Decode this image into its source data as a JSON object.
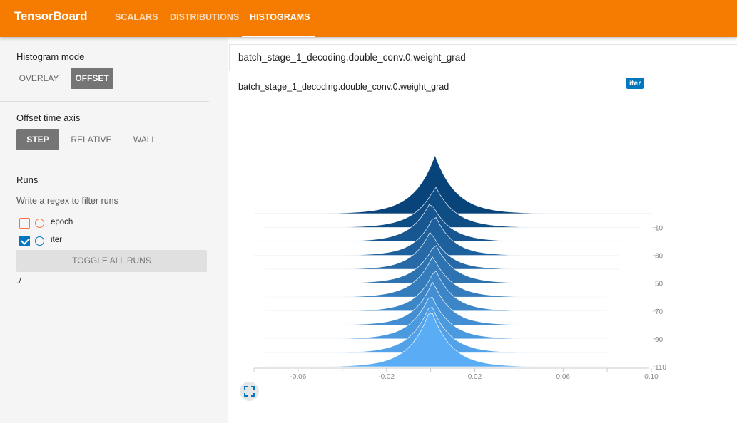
{
  "app": {
    "title": "TensorBoard",
    "tabs": [
      {
        "label": "SCALARS",
        "active": false
      },
      {
        "label": "DISTRIBUTIONS",
        "active": false
      },
      {
        "label": "HISTOGRAMS",
        "active": true
      }
    ],
    "accent_color": "#f57c00"
  },
  "sidebar": {
    "histogram_mode": {
      "title": "Histogram mode",
      "options": [
        "OVERLAY",
        "OFFSET"
      ],
      "selected": "OFFSET"
    },
    "offset_axis": {
      "title": "Offset time axis",
      "options": [
        "STEP",
        "RELATIVE",
        "WALL"
      ],
      "selected": "STEP"
    },
    "runs": {
      "title": "Runs",
      "filter_placeholder": "Write a regex to filter runs",
      "items": [
        {
          "name": "epoch",
          "checked": false,
          "color": "#ff7043"
        },
        {
          "name": "iter",
          "checked": true,
          "color": "#0277bd"
        }
      ],
      "toggle_all_label": "TOGGLE ALL RUNS",
      "logdir": "./"
    }
  },
  "main": {
    "tag_header": "batch_stage_1_decoding.double_conv.0.weight_grad",
    "card_title": "batch_stage_1_decoding.double_conv.0.weight_grad",
    "run_badge": "iter",
    "expand_icon": "fullscreen-icon"
  },
  "chart_data": {
    "type": "area",
    "mode": "offset",
    "x_axis": {
      "ticks": [
        "-0.06",
        "-0.02",
        "0.02",
        "0.06",
        "0.10"
      ],
      "tick_values": [
        -0.06,
        -0.02,
        0.02,
        0.06,
        0.1
      ],
      "range": [
        -0.08,
        0.1
      ]
    },
    "y_axis": {
      "label_ticks": [
        "10",
        "30",
        "50",
        "70",
        "90",
        "110"
      ],
      "tick_values": [
        10,
        30,
        50,
        70,
        90,
        110
      ],
      "range": [
        0,
        110
      ],
      "position": "right"
    },
    "series": [
      {
        "step": 0,
        "peak": 0.002,
        "height": 82,
        "spread": 0.0095,
        "left": -0.08,
        "right": 0.1
      },
      {
        "step": 10,
        "peak": 0.0022,
        "height": 58,
        "spread": 0.009,
        "left": -0.075,
        "right": 0.095
      },
      {
        "step": 20,
        "peak": 0.0,
        "height": 56,
        "spread": 0.0085,
        "left": -0.08,
        "right": 0.09
      },
      {
        "step": 30,
        "peak": 0.0018,
        "height": 58,
        "spread": 0.008,
        "left": -0.08,
        "right": 0.085
      },
      {
        "step": 40,
        "peak": 0.0,
        "height": 54,
        "spread": 0.008,
        "left": -0.075,
        "right": 0.085
      },
      {
        "step": 50,
        "peak": 0.002,
        "height": 56,
        "spread": 0.0085,
        "left": -0.075,
        "right": 0.08
      },
      {
        "step": 60,
        "peak": 0.001,
        "height": 58,
        "spread": 0.0085,
        "left": -0.075,
        "right": 0.08
      },
      {
        "step": 70,
        "peak": 0.002,
        "height": 60,
        "spread": 0.008,
        "left": -0.075,
        "right": 0.08
      },
      {
        "step": 80,
        "peak": 0.001,
        "height": 62,
        "spread": 0.008,
        "left": -0.075,
        "right": 0.08
      },
      {
        "step": 90,
        "peak": 0.0,
        "height": 64,
        "spread": 0.0085,
        "left": -0.075,
        "right": 0.08
      },
      {
        "step": 100,
        "peak": 0.0,
        "height": 70,
        "spread": 0.0085,
        "left": -0.075,
        "right": 0.08
      },
      {
        "step": 110,
        "peak": 0.0,
        "height": 82,
        "spread": 0.009,
        "left": -0.075,
        "right": 0.08
      }
    ],
    "color_oldest": "#08437a",
    "color_newest": "#5aacf4",
    "grid": false
  }
}
